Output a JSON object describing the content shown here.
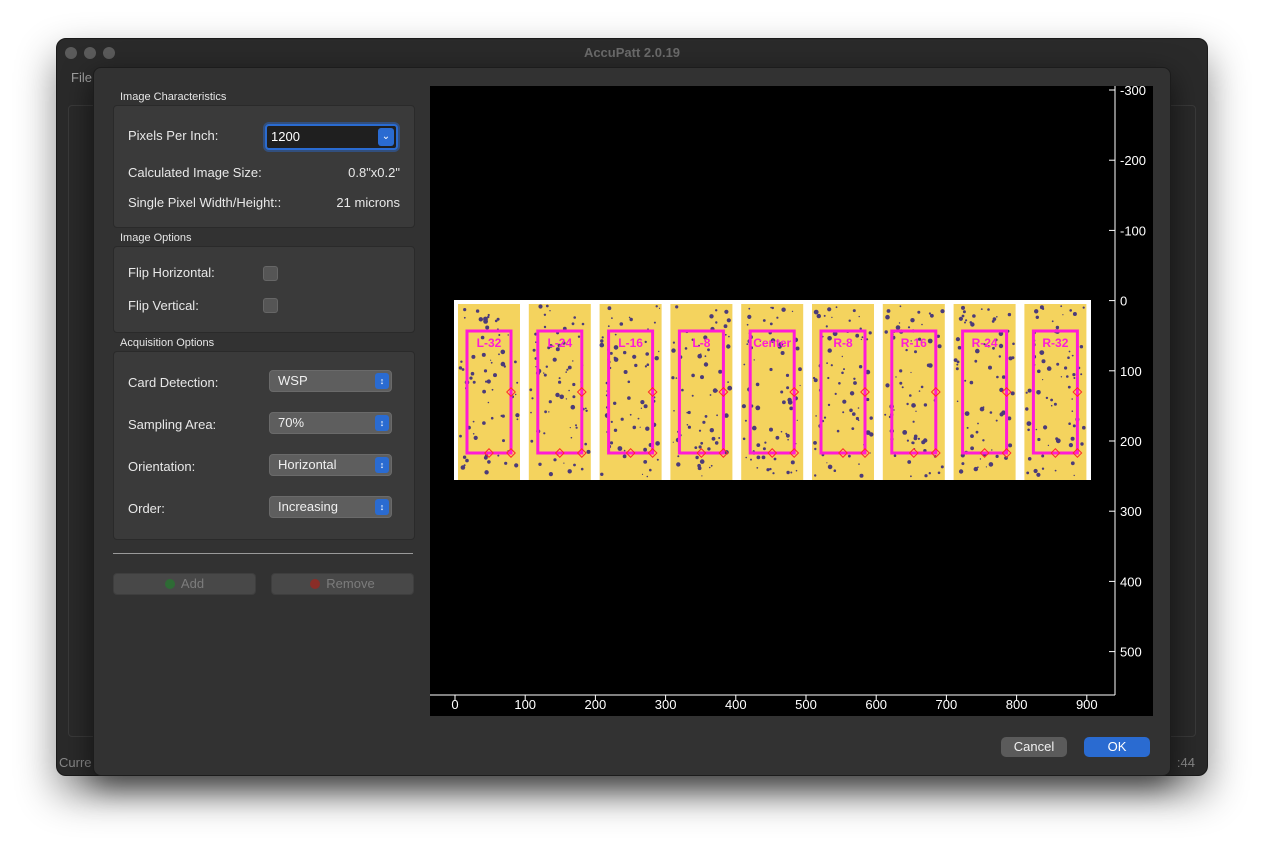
{
  "window": {
    "title": "AccuPatt 2.0.19",
    "menu_file": "File",
    "status_left": "Curre",
    "status_right": ":44"
  },
  "image_characteristics": {
    "title": "Image Characteristics",
    "ppi_label": "Pixels Per Inch:",
    "ppi_value": "1200",
    "calc_size_label": "Calculated Image Size:",
    "calc_size_value": "0.8\"x0.2\"",
    "pixel_size_label": "Single Pixel Width/Height::",
    "pixel_size_value": "21 microns"
  },
  "image_options": {
    "title": "Image Options",
    "flip_h_label": "Flip Horizontal:",
    "flip_v_label": "Flip Vertical:"
  },
  "acquisition_options": {
    "title": "Acquisition Options",
    "card_detection_label": "Card Detection:",
    "card_detection_value": "WSP",
    "sampling_area_label": "Sampling Area:",
    "sampling_area_value": "70%",
    "orientation_label": "Orientation:",
    "orientation_value": "Horizontal",
    "order_label": "Order:",
    "order_value": "Increasing"
  },
  "buttons": {
    "add": "Add",
    "remove": "Remove",
    "cancel": "Cancel",
    "ok": "OK"
  },
  "colors": {
    "accent": "#2a6bd1",
    "card_fill": "#f4d35e",
    "roi": "#ff1bd6",
    "add_dot": "#2e8b3a",
    "remove_dot": "#c0392b"
  },
  "plot": {
    "x_ticks": [
      "0",
      "100",
      "200",
      "300",
      "400",
      "500",
      "600",
      "700",
      "800",
      "900"
    ],
    "y_ticks": [
      "-300",
      "-200",
      "-100",
      "0",
      "100",
      "200",
      "300",
      "400",
      "500"
    ],
    "cards": [
      "L-32",
      "L-24",
      "L-16",
      "L-8",
      "Center",
      "R-8",
      "R-16",
      "R-24",
      "R-32"
    ]
  }
}
